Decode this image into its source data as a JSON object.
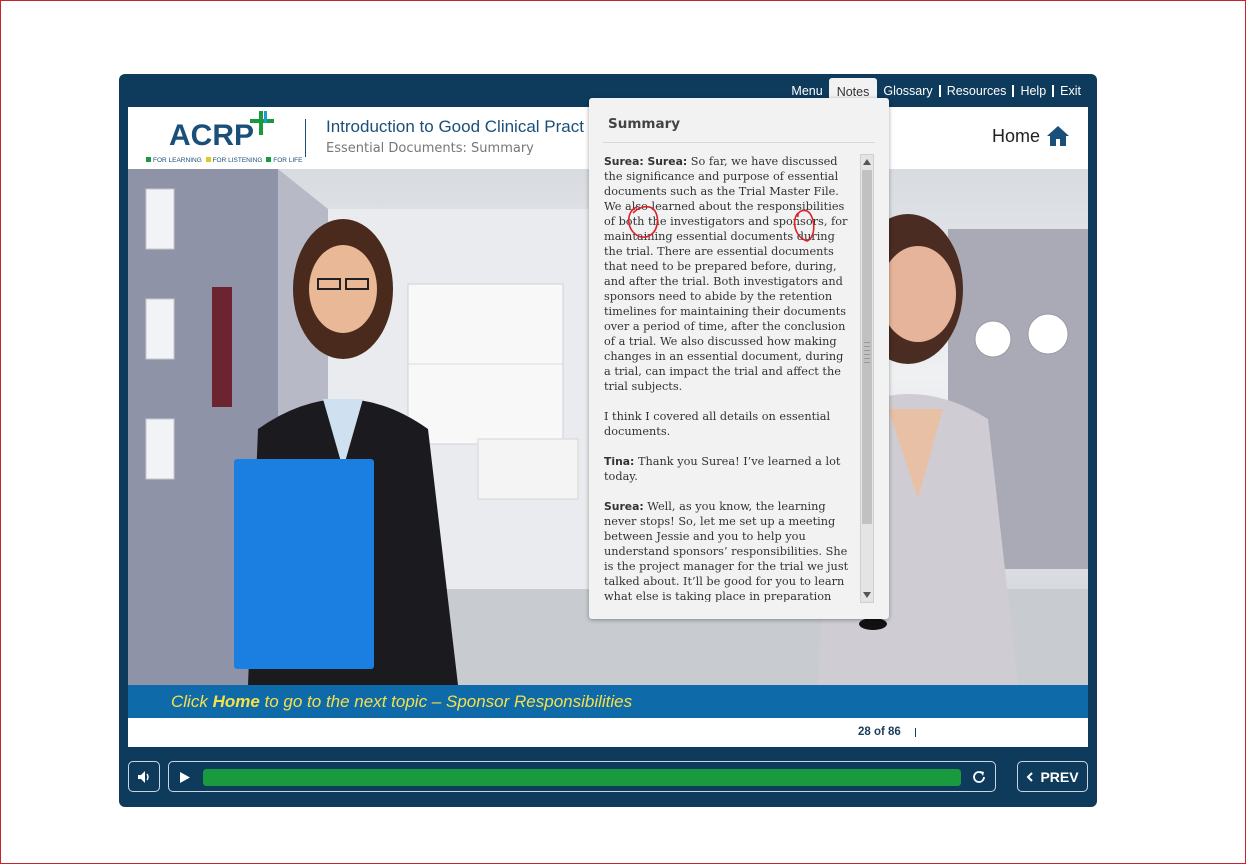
{
  "nav": {
    "menu": "Menu",
    "notes": "Notes",
    "glossary": "Glossary",
    "resources": "Resources",
    "help": "Help",
    "exit": "Exit"
  },
  "header": {
    "logo_text": "ACRP",
    "logo_tagline": [
      "FOR LEARNING",
      "FOR LISTENING",
      "FOR LIFE"
    ],
    "course_title": "Introduction to Good Clinical Pract",
    "slide_title": "Essential Documents: Summary",
    "home_label": "Home"
  },
  "caption": {
    "prefix": "Click ",
    "bold": "Home",
    "suffix": " to go to the next topic – Sponsor Responsibilities"
  },
  "pager": {
    "count": "28 of 86"
  },
  "controls": {
    "prev_label": "PREV",
    "progress_fraction": 1.0
  },
  "notes": {
    "title": "Summary",
    "paragraphs": [
      {
        "speaker": "Surea: Surea:",
        "text": " So far, we have discussed the significance and purpose of essential documents such as the Trial Master File. We also learned about the responsibilities of both the investigators and sponsors, for maintaining essential documents during the trial. There are essential documents that need to be prepared before, during, and after the trial. Both investigators and sponsors need to abide by the retention timelines for maintaining their documents over a period of time, after the conclusion of a trial. We also discussed how making changes in an essential document, during a trial, can impact the trial and affect the trial subjects."
      },
      {
        "speaker": "",
        "text": "I think I covered all details on essential documents."
      },
      {
        "speaker": "Tina:",
        "text": " Thank you Surea! I’ve learned a lot today."
      },
      {
        "speaker": "Surea:",
        "text": " Well, as you know, the learning never stops! So, let me set up a meeting between Jessie and you to help you understand sponsors’ responsibilities. She is the project manager for the trial we just talked about. It’ll be good for you to learn what else is taking place in preparation for a new study,"
      }
    ]
  },
  "colors": {
    "frame": "#0e3a5c",
    "caption_bg": "#0e6aa8",
    "caption_text": "#f6e04a",
    "progress": "#199a3f",
    "annotation": "#d8232a"
  }
}
